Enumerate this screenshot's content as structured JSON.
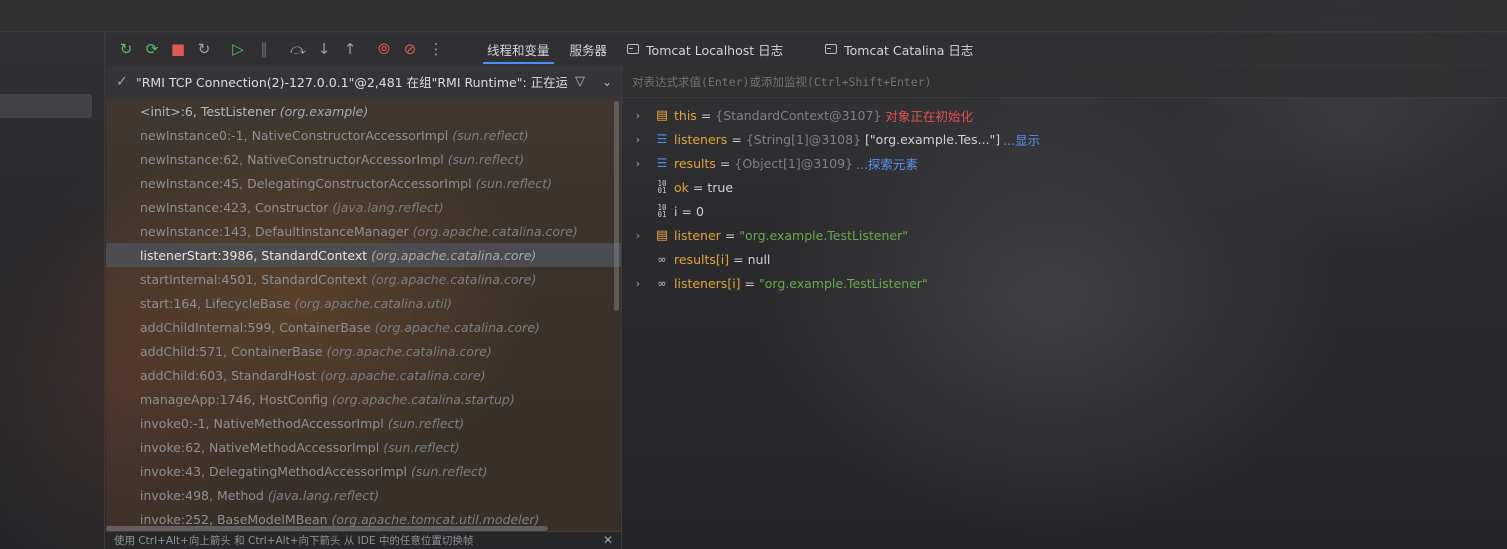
{
  "toolbar": {
    "buttons": [
      {
        "name": "rerun-icon",
        "glyph": "↻",
        "color": "green"
      },
      {
        "name": "reload-icon",
        "glyph": "⟳",
        "color": "green"
      },
      {
        "name": "stop-icon",
        "glyph": "■",
        "color": "red"
      },
      {
        "name": "restart-icon",
        "glyph": "↻",
        "color": "gray"
      },
      {
        "name": "resume-icon",
        "glyph": "▷",
        "color": "green"
      },
      {
        "name": "pause-icon",
        "glyph": "‖",
        "color": "dim"
      },
      {
        "name": "step-over-icon",
        "glyph": "⤼",
        "color": "gray"
      },
      {
        "name": "step-into-icon",
        "glyph": "↓",
        "color": "gray"
      },
      {
        "name": "step-out-icon",
        "glyph": "↑",
        "color": "gray"
      },
      {
        "name": "view-breakpoints-icon",
        "glyph": "⦾",
        "color": "red"
      },
      {
        "name": "mute-breakpoints-icon",
        "glyph": "⊘",
        "color": "red"
      },
      {
        "name": "more-options-icon",
        "glyph": "⋮",
        "color": "gray"
      }
    ],
    "tabs": [
      {
        "label": "线程和变量",
        "active": true,
        "icon": false
      },
      {
        "label": "服务器",
        "active": false,
        "icon": false
      },
      {
        "label": "Tomcat Localhost 日志",
        "active": false,
        "icon": true
      },
      {
        "label": "Tomcat Catalina 日志",
        "active": false,
        "icon": true
      }
    ]
  },
  "thread": {
    "label": "\"RMI TCP Connection(2)-127.0.0.1\"@2,481 在组\"RMI Runtime\": 正在运行"
  },
  "frames": [
    {
      "method": "<init>:6, TestListener",
      "pkg": "(org.example)",
      "state": "top"
    },
    {
      "method": "newInstance0:-1, NativeConstructorAccessorImpl",
      "pkg": "(sun.reflect)",
      "state": ""
    },
    {
      "method": "newInstance:62, NativeConstructorAccessorImpl",
      "pkg": "(sun.reflect)",
      "state": ""
    },
    {
      "method": "newInstance:45, DelegatingConstructorAccessorImpl",
      "pkg": "(sun.reflect)",
      "state": ""
    },
    {
      "method": "newInstance:423, Constructor",
      "pkg": "(java.lang.reflect)",
      "state": ""
    },
    {
      "method": "newInstance:143, DefaultInstanceManager",
      "pkg": "(org.apache.catalina.core)",
      "state": ""
    },
    {
      "method": "listenerStart:3986, StandardContext",
      "pkg": "(org.apache.catalina.core)",
      "state": "sel"
    },
    {
      "method": "startInternal:4501, StandardContext",
      "pkg": "(org.apache.catalina.core)",
      "state": ""
    },
    {
      "method": "start:164, LifecycleBase",
      "pkg": "(org.apache.catalina.util)",
      "state": ""
    },
    {
      "method": "addChildInternal:599, ContainerBase",
      "pkg": "(org.apache.catalina.core)",
      "state": ""
    },
    {
      "method": "addChild:571, ContainerBase",
      "pkg": "(org.apache.catalina.core)",
      "state": ""
    },
    {
      "method": "addChild:603, StandardHost",
      "pkg": "(org.apache.catalina.core)",
      "state": ""
    },
    {
      "method": "manageApp:1746, HostConfig",
      "pkg": "(org.apache.catalina.startup)",
      "state": ""
    },
    {
      "method": "invoke0:-1, NativeMethodAccessorImpl",
      "pkg": "(sun.reflect)",
      "state": ""
    },
    {
      "method": "invoke:62, NativeMethodAccessorImpl",
      "pkg": "(sun.reflect)",
      "state": ""
    },
    {
      "method": "invoke:43, DelegatingMethodAccessorImpl",
      "pkg": "(sun.reflect)",
      "state": ""
    },
    {
      "method": "invoke:498, Method",
      "pkg": "(java.lang.reflect)",
      "state": ""
    },
    {
      "method": "invoke:252, BaseModelMBean",
      "pkg": "(org.apache.tomcat.util.modeler)",
      "state": ""
    }
  ],
  "status_hint": "使用 Ctrl+Alt+向上箭头 和 Ctrl+Alt+向下箭头 从 IDE 中的任意位置切换帧",
  "eval_placeholder": "对表达式求值(Enter)或添加监视(Ctrl+Shift+Enter)",
  "variables": [
    {
      "expand": true,
      "icon": "field",
      "name": "this",
      "name_style": "field",
      "type": "{StandardContext@3107}",
      "value": "",
      "value_style": "",
      "warn": "对象正在初始化",
      "link": ""
    },
    {
      "expand": true,
      "icon": "array",
      "name": "listeners",
      "name_style": "field",
      "type": "{String[1]@3108}",
      "value": "[\"org.example.Tes...\"]",
      "value_style": "",
      "warn": "",
      "link": "...显示"
    },
    {
      "expand": true,
      "icon": "array",
      "name": "results",
      "name_style": "field",
      "type": "{Object[1]@3109}",
      "value": "",
      "value_style": "",
      "warn": "",
      "link": "...探索元素"
    },
    {
      "expand": false,
      "icon": "prim",
      "name": "ok",
      "name_style": "field",
      "type": "",
      "value": "true",
      "value_style": "",
      "warn": "",
      "link": ""
    },
    {
      "expand": false,
      "icon": "prim",
      "name": "i",
      "name_style": "plain",
      "type": "",
      "value": "0",
      "value_style": "",
      "warn": "",
      "link": ""
    },
    {
      "expand": true,
      "icon": "field",
      "name": "listener",
      "name_style": "field",
      "type": "",
      "value": "\"org.example.TestListener\"",
      "value_style": "str",
      "warn": "",
      "link": ""
    },
    {
      "expand": false,
      "icon": "watch",
      "name": "results[i]",
      "name_style": "field",
      "type": "",
      "value": "null",
      "value_style": "",
      "warn": "",
      "link": ""
    },
    {
      "expand": true,
      "icon": "watch",
      "name": "listeners[i]",
      "name_style": "field",
      "type": "",
      "value": "\"org.example.TestListener\"",
      "value_style": "str",
      "warn": "",
      "link": ""
    }
  ],
  "colors": {
    "accent": "#4d8ef6",
    "string_value": "#6aa84f",
    "field_name": "#e0a23e",
    "warning": "#e05252",
    "link": "#5b8ef0"
  }
}
